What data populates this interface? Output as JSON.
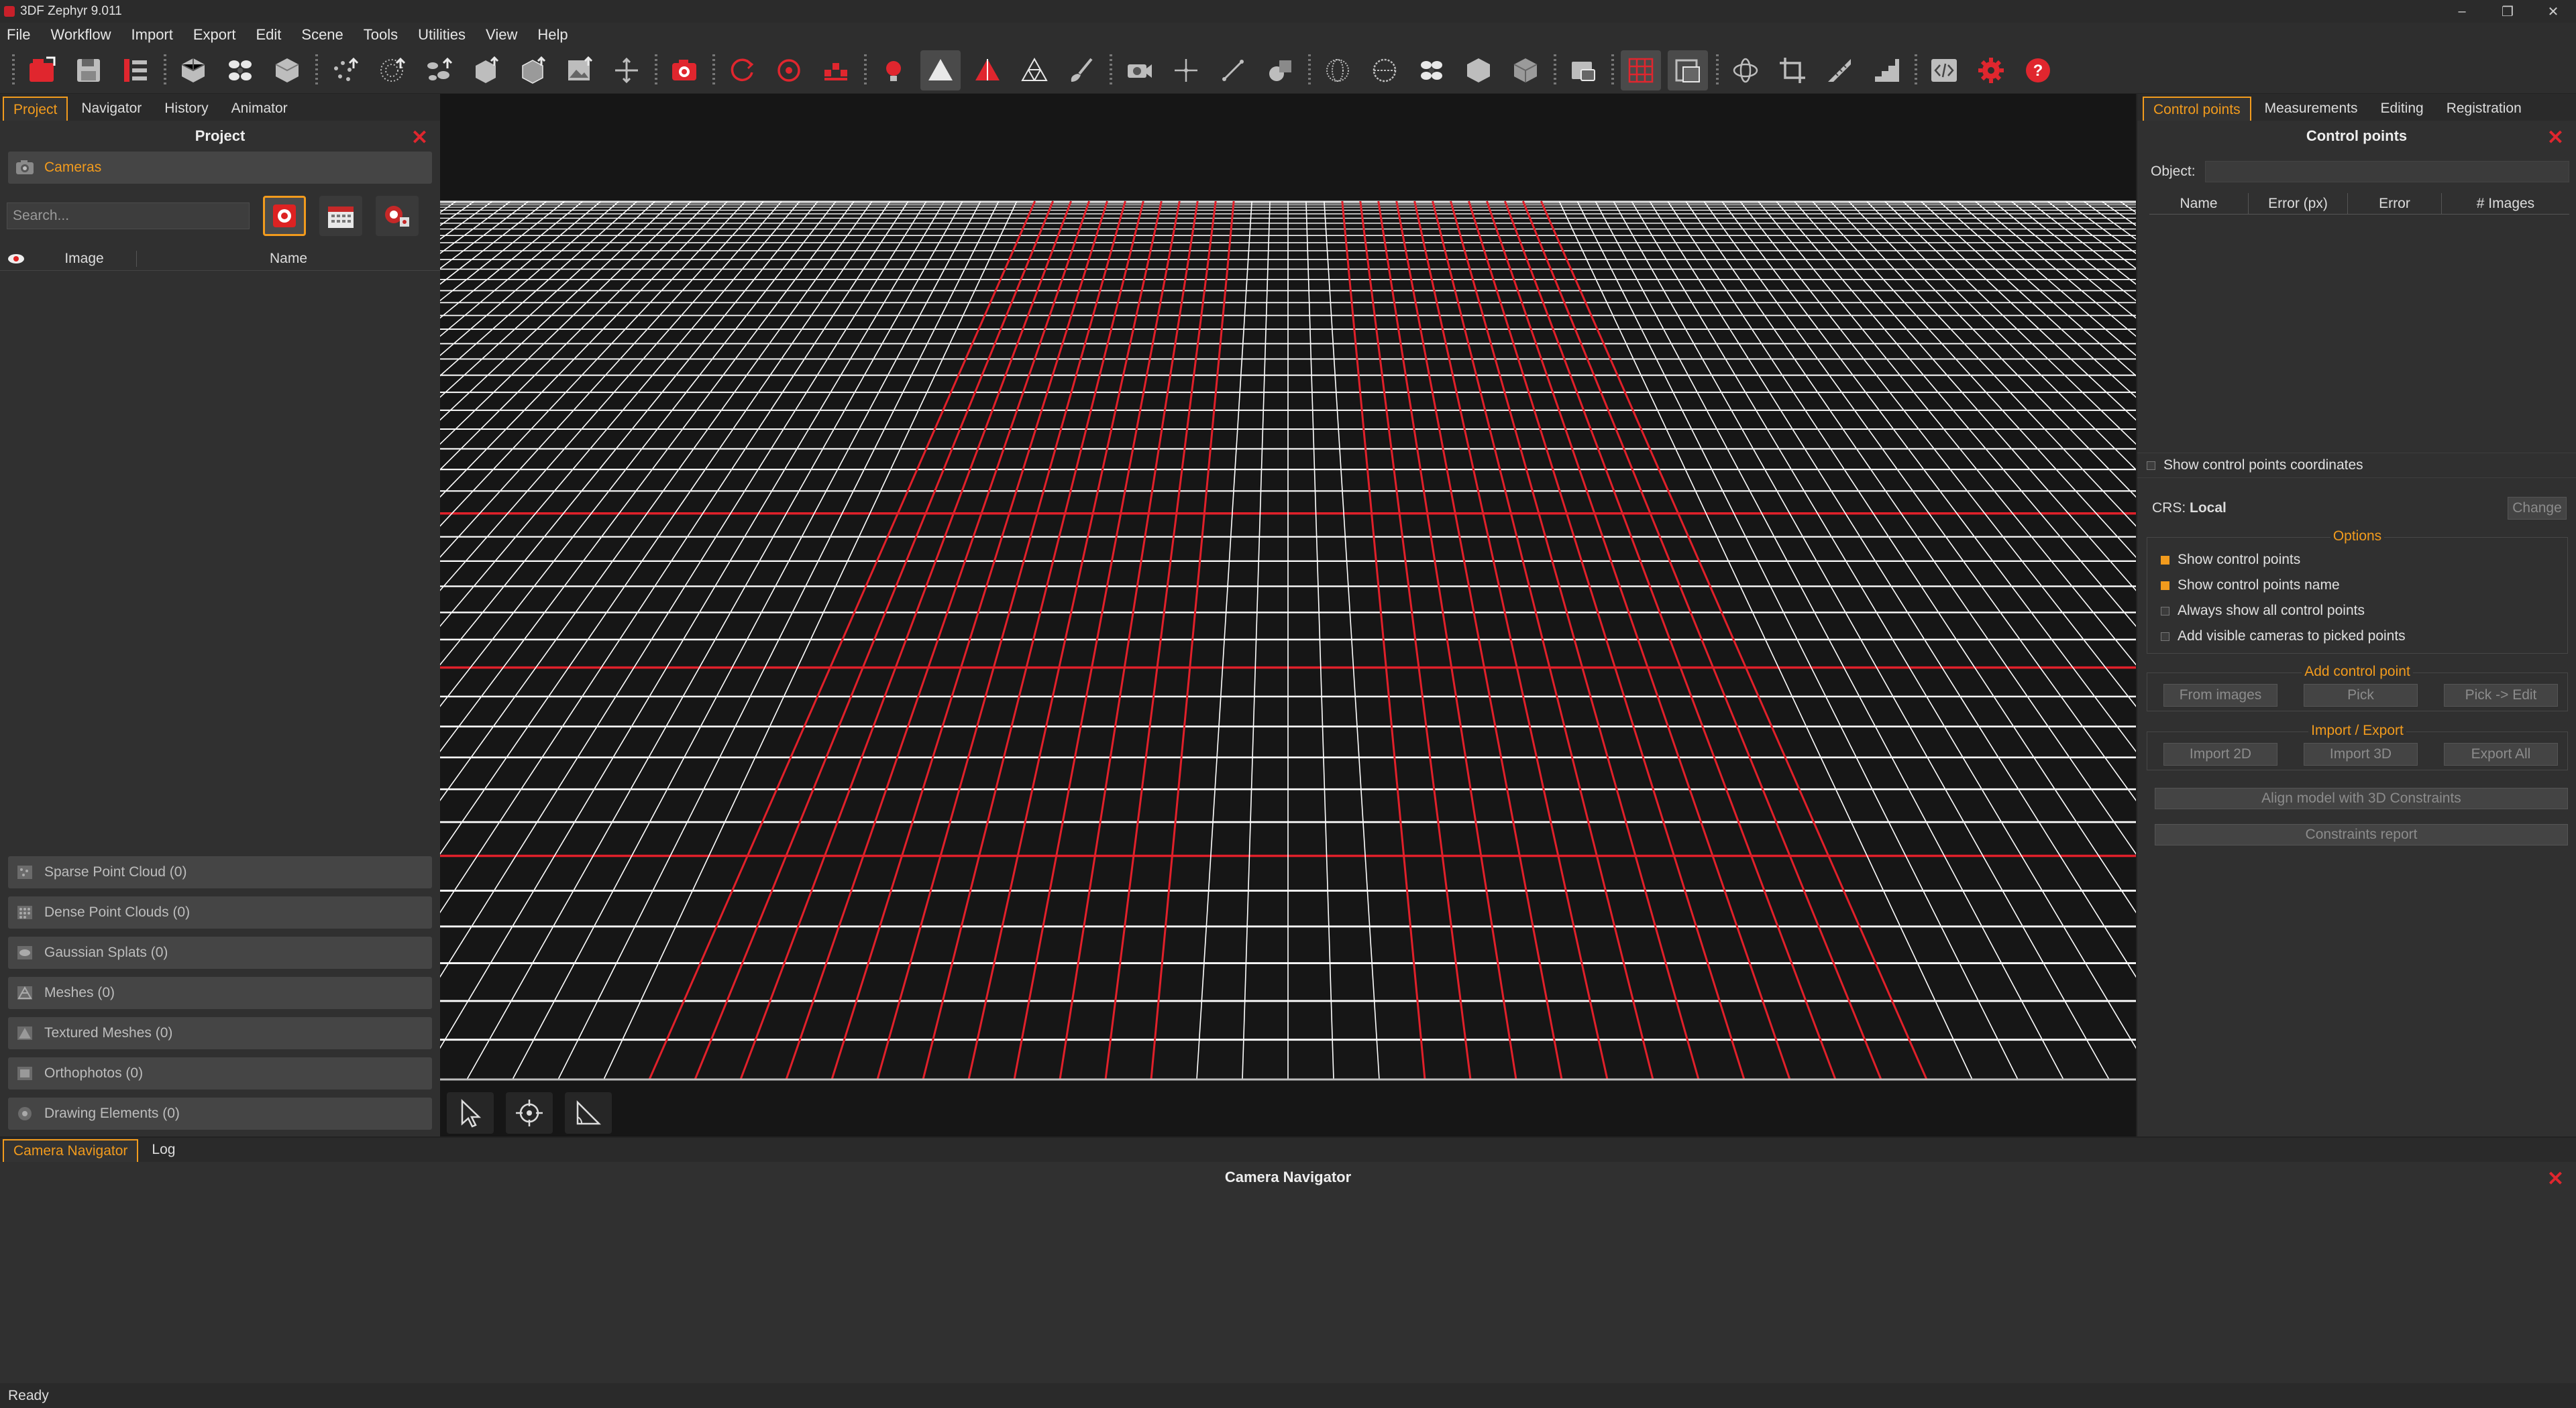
{
  "window": {
    "title": "3DF Zephyr 9.011",
    "controls": [
      "–",
      "❐",
      "✕"
    ]
  },
  "menu": [
    "File",
    "Workflow",
    "Import",
    "Export",
    "Edit",
    "Scene",
    "Tools",
    "Utilities",
    "View",
    "Help"
  ],
  "toolbar": {
    "groups": [
      [
        "new-project-icon",
        "save-icon",
        "timeline-icon"
      ],
      [
        "cube-icon",
        "scatter-icon",
        "solid-cube-icon"
      ],
      [
        "sparse-cloud-icon",
        "dense-cloud-icon",
        "splat-icon",
        "mesh-icon",
        "textured-mesh-icon",
        "image-icon",
        "transform-icon"
      ],
      [
        "camera-icon"
      ],
      [
        "rotate-icon",
        "orbit-icon",
        "control-points-icon"
      ],
      [
        "light-icon",
        "triangle-icon",
        "red-triangle-icon",
        "wireframe-icon",
        "brush-icon"
      ],
      [
        "camera-move-icon",
        "move-icon",
        "measure-line-icon",
        "shapes-icon"
      ],
      [
        "sphere-grid-icon",
        "sphere-icon",
        "flower-icon",
        "hex-cube-icon",
        "box-icon"
      ],
      [
        "screenshot-icon"
      ],
      [
        "grid-icon",
        "layers-icon"
      ],
      [
        "orbit-3d-icon",
        "crop-icon",
        "ruler-icon",
        "stairs-icon"
      ],
      [
        "code-icon",
        "settings-icon",
        "help-icon"
      ]
    ],
    "active": [
      "triangle-icon",
      "grid-icon",
      "layers-icon"
    ]
  },
  "left_panel": {
    "tabs": [
      "Project",
      "Navigator",
      "History",
      "Animator"
    ],
    "active_tab": "Project",
    "title": "Project",
    "cameras_label": "Cameras",
    "search_placeholder": "Search...",
    "columns": {
      "image": "Image",
      "name": "Name"
    },
    "sections": [
      "Sparse Point Cloud (0)",
      "Dense Point Clouds (0)",
      "Gaussian Splats (0)",
      "Meshes (0)",
      "Textured Meshes (0)",
      "Orthophotos (0)",
      "Drawing Elements (0)"
    ]
  },
  "viewport": {
    "tools": [
      "select-arrow-icon",
      "target-icon",
      "angle-tool-icon"
    ],
    "grid_color": "#ffffff",
    "grid_highlight_color": "#e0202a"
  },
  "right_panel": {
    "tabs": [
      "Control points",
      "Measurements",
      "Editing",
      "Registration"
    ],
    "active_tab": "Control points",
    "title": "Control points",
    "object_label": "Object:",
    "table_columns": [
      "Name",
      "Error (px)",
      "Error",
      "# Images"
    ],
    "show_coords_label": "Show control points coordinates",
    "crs_label": "CRS:",
    "crs_value": "Local",
    "change_label": "Change",
    "options_title": "Options",
    "options": [
      {
        "label": "Show control points",
        "checked": true
      },
      {
        "label": "Show control points name",
        "checked": true
      },
      {
        "label": "Always show all control points",
        "checked": false
      },
      {
        "label": "Add visible cameras to picked points",
        "checked": false
      }
    ],
    "add_title": "Add control point",
    "add_buttons": [
      "From images",
      "Pick",
      "Pick -> Edit"
    ],
    "io_title": "Import / Export",
    "io_buttons": [
      "Import 2D",
      "Import 3D",
      "Export All"
    ],
    "align_label": "Align model with 3D Constraints",
    "report_label": "Constraints report"
  },
  "bottom_panel": {
    "tabs": [
      "Camera Navigator",
      "Log"
    ],
    "active_tab": "Camera Navigator",
    "title": "Camera Navigator"
  },
  "status": {
    "text": "Ready"
  },
  "colors": {
    "accent": "#f29b1d",
    "brand_red": "#e0262e"
  }
}
